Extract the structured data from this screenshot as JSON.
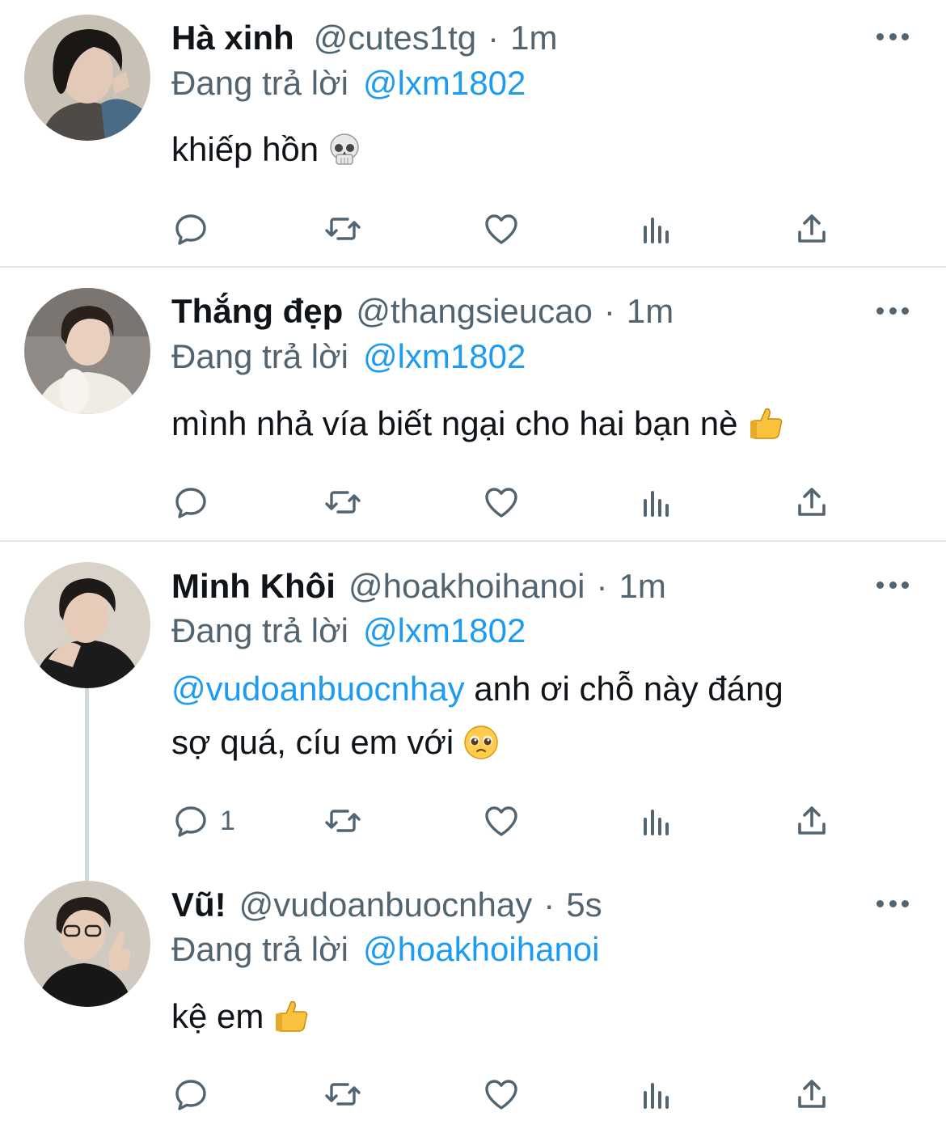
{
  "tweets": [
    {
      "display_name": "Hà xinh",
      "handle": "@cutes1tg",
      "separator": "·",
      "time": "1m",
      "reply_label": "Đang trả lời",
      "reply_to": "@lxm1802",
      "text": "khiếp hồn",
      "emoji": "skull-emoji",
      "reply_count": "",
      "avatar_colors": {
        "bg": "#c8c1b6",
        "hair": "#1b1714",
        "skin": "#e3c9b7",
        "cloth": "#4a6b86"
      }
    },
    {
      "display_name": "Thắng đẹp",
      "handle": "@thangsieucao",
      "separator": "·",
      "time": "1m",
      "reply_label": "Đang trả lời",
      "reply_to": "@lxm1802",
      "text": "mình nhả vía biết ngại cho hai bạn nè",
      "emoji": "thumbs-up-emoji",
      "reply_count": "",
      "avatar_colors": {
        "bg": "#8f8a86",
        "hair": "#2a211b",
        "skin": "#e9cfbd",
        "cloth": "#f1ece3"
      }
    },
    {
      "display_name": "Minh Khôi",
      "handle": "@hoakhoihanoi",
      "separator": "·",
      "time": "1m",
      "reply_label": "Đang trả lời",
      "reply_to": "@lxm1802",
      "text_mention": "@vudoanbuocnhay",
      "text_line1": "anh ơi chỗ này đáng",
      "text_line2": "sợ quá, cíu em với",
      "emoji": "pleading-face-emoji",
      "reply_count": "1",
      "avatar_colors": {
        "bg": "#d9d2c8",
        "hair": "#1e1a18",
        "skin": "#e6cbb8",
        "cloth": "#1b1b1b"
      }
    },
    {
      "display_name": "Vũ!",
      "handle": "@vudoanbuocnhay",
      "separator": "·",
      "time": "5s",
      "reply_label": "Đang trả lời",
      "reply_to": "@hoakhoihanoi",
      "text": "kệ em",
      "emoji": "thumbs-up-emoji",
      "reply_count": "",
      "avatar_colors": {
        "bg": "#cfc9c0",
        "hair": "#241d19",
        "skin": "#e7ccb8",
        "cloth": "#171717"
      }
    }
  ],
  "icons": {
    "reply": "reply-icon",
    "retweet": "retweet-icon",
    "like": "like-icon",
    "views": "views-icon",
    "share": "share-icon",
    "more": "more-icon"
  },
  "colors": {
    "text": "#0f1419",
    "secondary": "#536471",
    "link": "#1d9bf0",
    "divider": "#e1e8ed",
    "thread_line": "#cfd9de"
  }
}
